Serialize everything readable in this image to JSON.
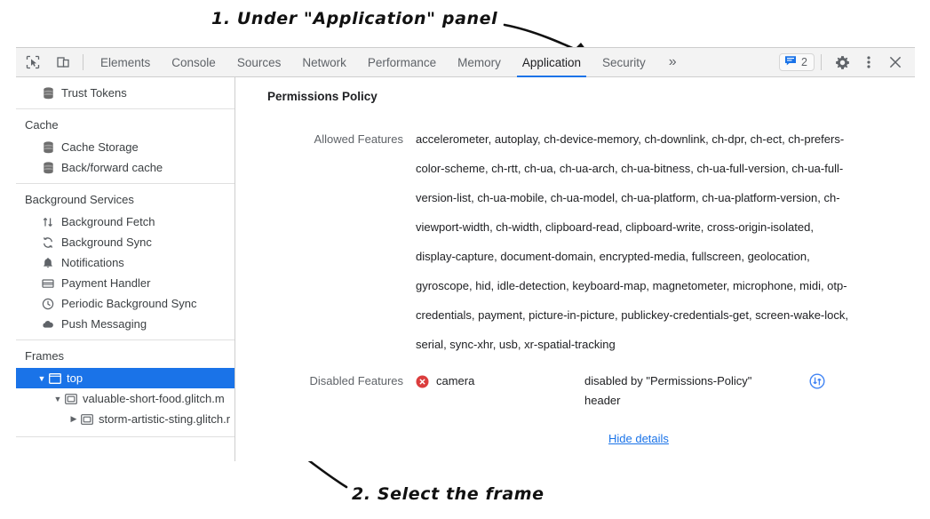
{
  "annotations": {
    "step1": "1. Under \"Application\" panel",
    "step2": "2. Select the frame"
  },
  "toolbar": {
    "inspect_icon": "inspect-element-icon",
    "device_icon": "device-toolbar-icon",
    "tabs": [
      {
        "label": "Elements",
        "active": false
      },
      {
        "label": "Console",
        "active": false
      },
      {
        "label": "Sources",
        "active": false
      },
      {
        "label": "Network",
        "active": false
      },
      {
        "label": "Performance",
        "active": false
      },
      {
        "label": "Memory",
        "active": false
      },
      {
        "label": "Application",
        "active": true
      },
      {
        "label": "Security",
        "active": false
      }
    ],
    "more_tabs": "»",
    "message_count": "2",
    "message_icon": "message-icon",
    "settings_icon": "gear-icon",
    "menu_icon": "kebab-menu-icon",
    "close_icon": "close-icon",
    "accent_color": "#1a73e8"
  },
  "sidebar": {
    "top_items": [
      {
        "label": "Trust Tokens",
        "icon": "database-icon"
      }
    ],
    "groups": [
      {
        "header": "Cache",
        "items": [
          {
            "label": "Cache Storage",
            "icon": "database-icon"
          },
          {
            "label": "Back/forward cache",
            "icon": "database-icon"
          }
        ]
      },
      {
        "header": "Background Services",
        "items": [
          {
            "label": "Background Fetch",
            "icon": "arrows-up-down-icon"
          },
          {
            "label": "Background Sync",
            "icon": "sync-icon"
          },
          {
            "label": "Notifications",
            "icon": "bell-icon"
          },
          {
            "label": "Payment Handler",
            "icon": "credit-card-icon"
          },
          {
            "label": "Periodic Background Sync",
            "icon": "clock-icon"
          },
          {
            "label": "Push Messaging",
            "icon": "cloud-icon"
          }
        ]
      }
    ],
    "frames": {
      "header": "Frames",
      "tree": [
        {
          "label": "top",
          "icon": "frame-top-icon",
          "twisty": "▼",
          "depth": 1,
          "selected": true
        },
        {
          "label": "valuable-short-food.glitch.m",
          "icon": "frame-icon",
          "twisty": "▼",
          "depth": 2,
          "selected": false
        },
        {
          "label": "storm-artistic-sting.glitch.r",
          "icon": "frame-icon",
          "twisty": "▶",
          "depth": 3,
          "selected": false
        }
      ],
      "selected_color": "#1a73e8"
    }
  },
  "main": {
    "panel_title": "Permissions Policy",
    "allowed": {
      "label": "Allowed Features",
      "value": "accelerometer, autoplay, ch-device-memory, ch-downlink, ch-dpr, ch-ect, ch-prefers-color-scheme, ch-rtt, ch-ua, ch-ua-arch, ch-ua-bitness, ch-ua-full-version, ch-ua-full-version-list, ch-ua-mobile, ch-ua-model, ch-ua-platform, ch-ua-platform-version, ch-viewport-width, ch-width, clipboard-read, clipboard-write, cross-origin-isolated, display-capture, document-domain, encrypted-media, fullscreen, geolocation, gyroscope, hid, idle-detection, keyboard-map, magnetometer, microphone, midi, otp-credentials, payment, picture-in-picture, publickey-credentials-get, screen-wake-lock, serial, sync-xhr, usb, xr-spatial-tracking"
    },
    "disabled": {
      "label": "Disabled Features",
      "feature": "camera",
      "feature_icon": "error-circle-icon",
      "reason": "disabled by \"Permissions-Policy\" header",
      "request_icon": "network-request-icon",
      "hide_details_label": "Hide details",
      "error_color": "#db3d3d",
      "link_color": "#1a73e8"
    }
  }
}
